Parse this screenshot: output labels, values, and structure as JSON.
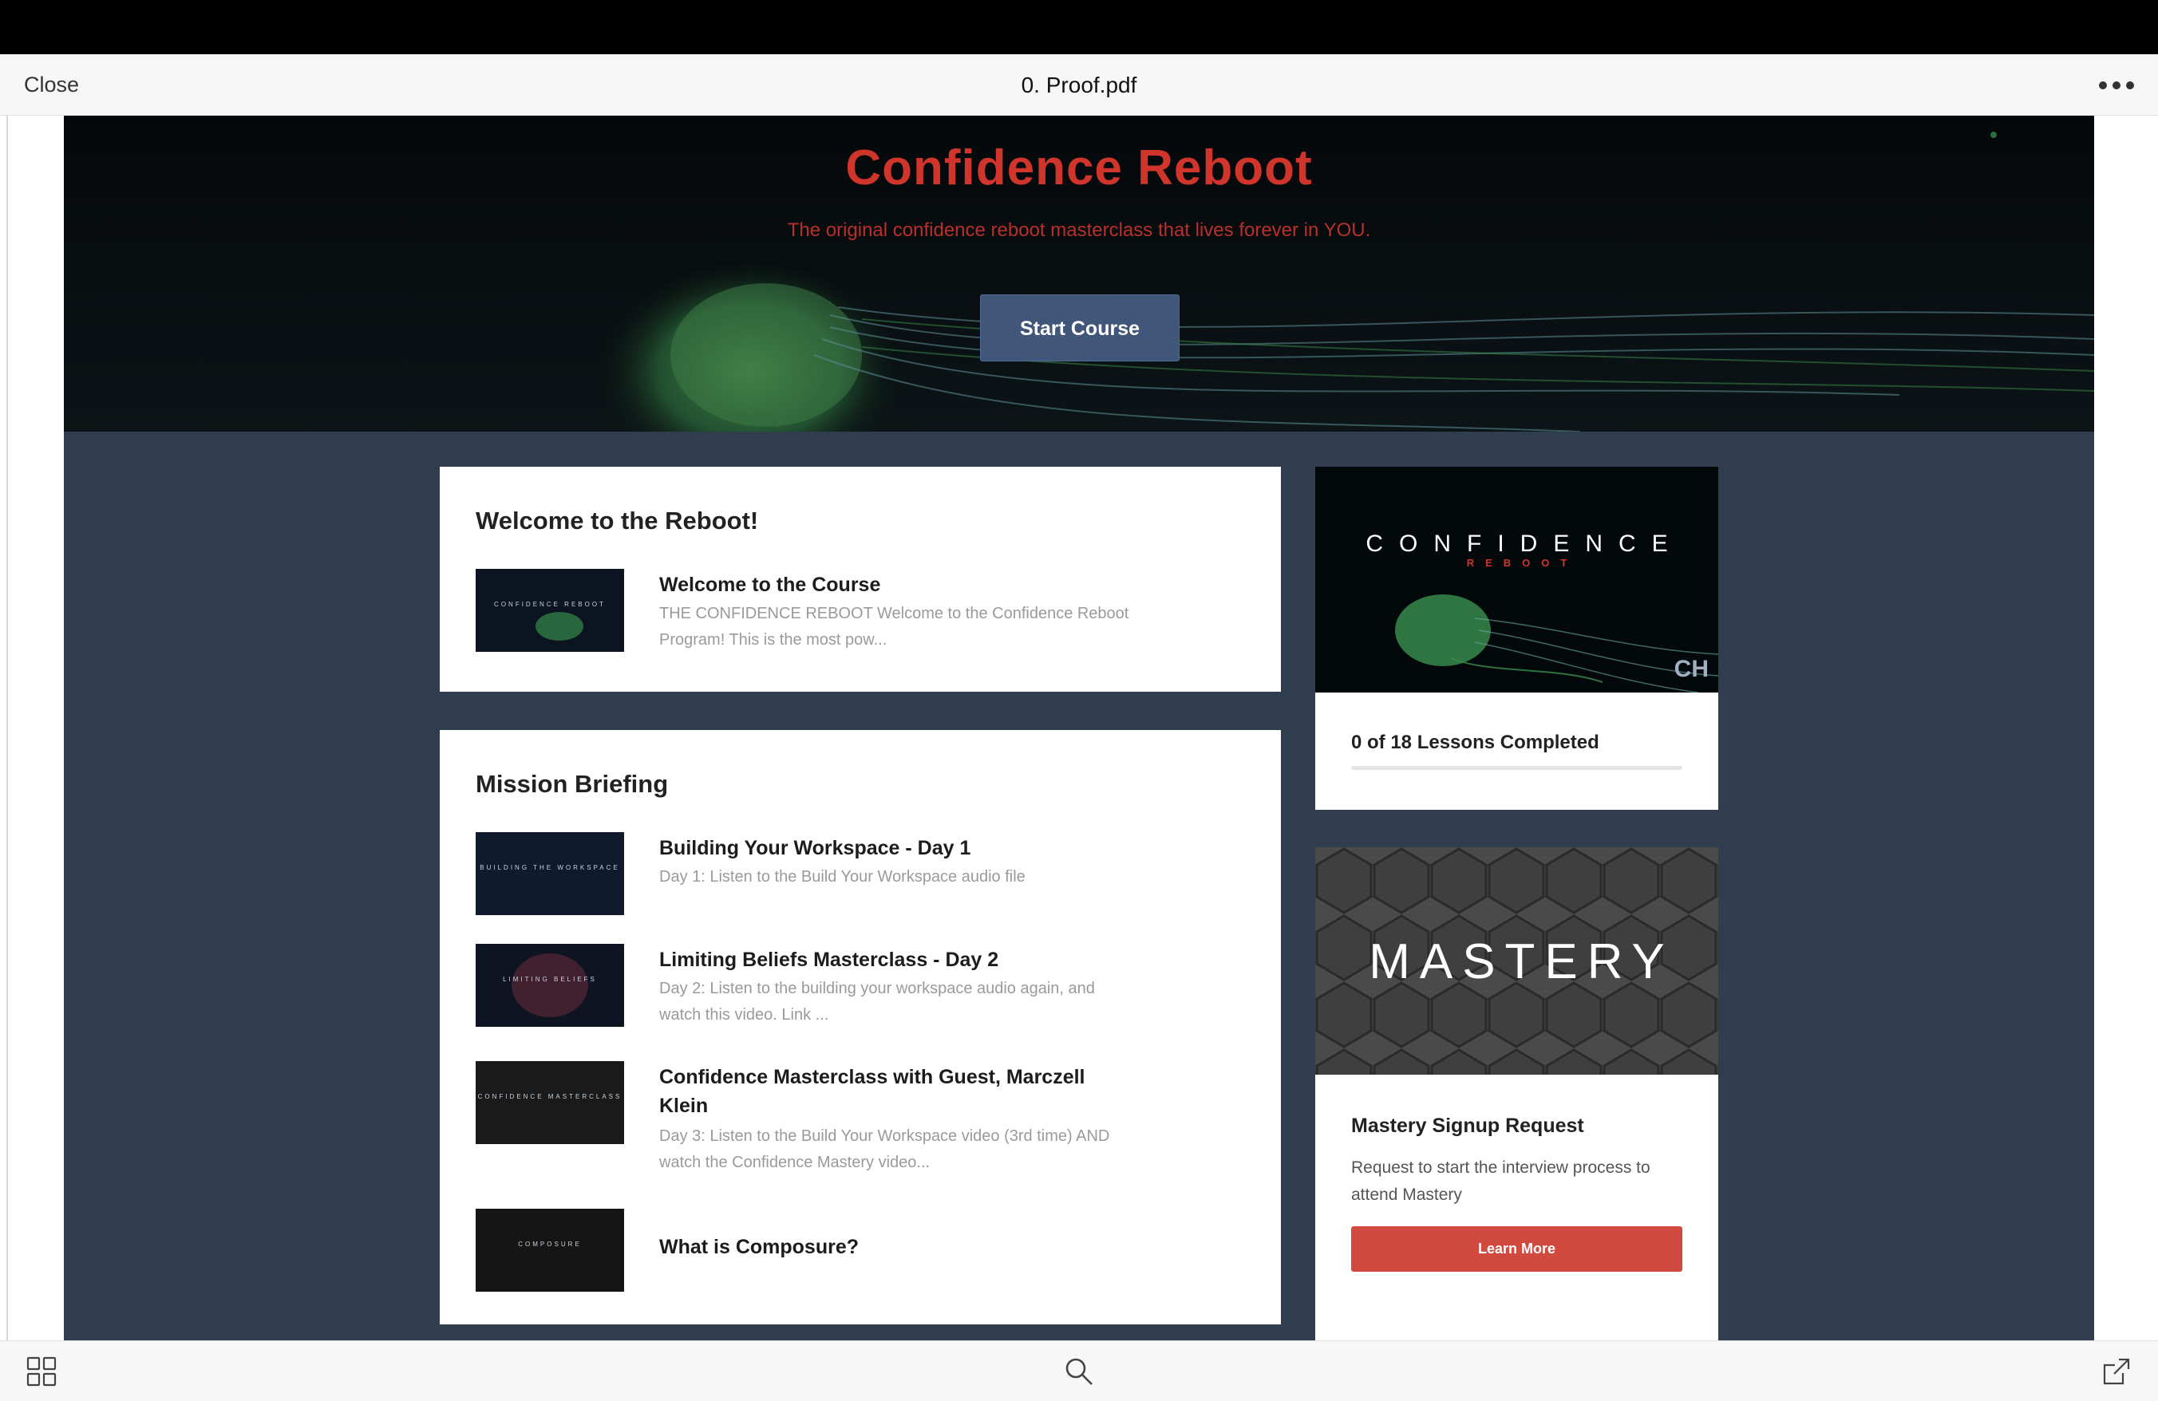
{
  "viewer": {
    "close_label": "Close",
    "document_title": "0. Proof.pdf",
    "more_icon": "ellipsis-icon",
    "bottom_icons": [
      "thumbnails-grid-icon",
      "search-icon",
      "share-icon"
    ]
  },
  "hero": {
    "title": "Confidence Reboot",
    "subtitle": "The original confidence reboot masterclass that lives forever in YOU.",
    "start_button": "Start Course"
  },
  "welcome_section": {
    "title": "Welcome to the Reboot!",
    "lessons": [
      {
        "title": "Welcome to the Course",
        "description": "THE CONFIDENCE REBOOT   Welcome to the Confidence Reboot Program!  This is the most pow...",
        "thumb_text": "CONFIDENCE REBOOT"
      }
    ]
  },
  "mission_section": {
    "title": "Mission Briefing",
    "lessons": [
      {
        "title": "Building Your Workspace - Day 1",
        "description": "Day 1: Listen to the Build Your Workspace audio file",
        "thumb_text": "BUILDING THE WORKSPACE"
      },
      {
        "title": "Limiting Beliefs Masterclass - Day 2",
        "description": "Day 2: Listen to the building your workspace audio again, and watch this video.   Link ...",
        "thumb_text": "LIMITING BELIEFS"
      },
      {
        "title": "Confidence Masterclass with Guest, Marczell Klein",
        "description": "Day 3: Listen to the Build Your Workspace video (3rd time) AND watch the Confidence Mastery video...",
        "thumb_text": "CONFIDENCE MASTERCLASS"
      },
      {
        "title": "What is Composure?",
        "description": "",
        "thumb_text": "COMPOSURE"
      }
    ]
  },
  "progress_card": {
    "image_word": "CONFIDENCE",
    "image_subword": "REBOOT",
    "logo_text": "CH",
    "label": "0 of 18 Lessons Completed",
    "completed": 0,
    "total": 18
  },
  "mastery_card": {
    "image_word": "MASTERY",
    "title": "Mastery Signup Request",
    "description": "Request to start the interview process to attend Mastery",
    "button": "Learn More"
  },
  "colors": {
    "accent_red": "#d0352c",
    "page_bg": "#2f3d4e",
    "start_button": "#41577a",
    "learn_button": "#d14a40"
  }
}
